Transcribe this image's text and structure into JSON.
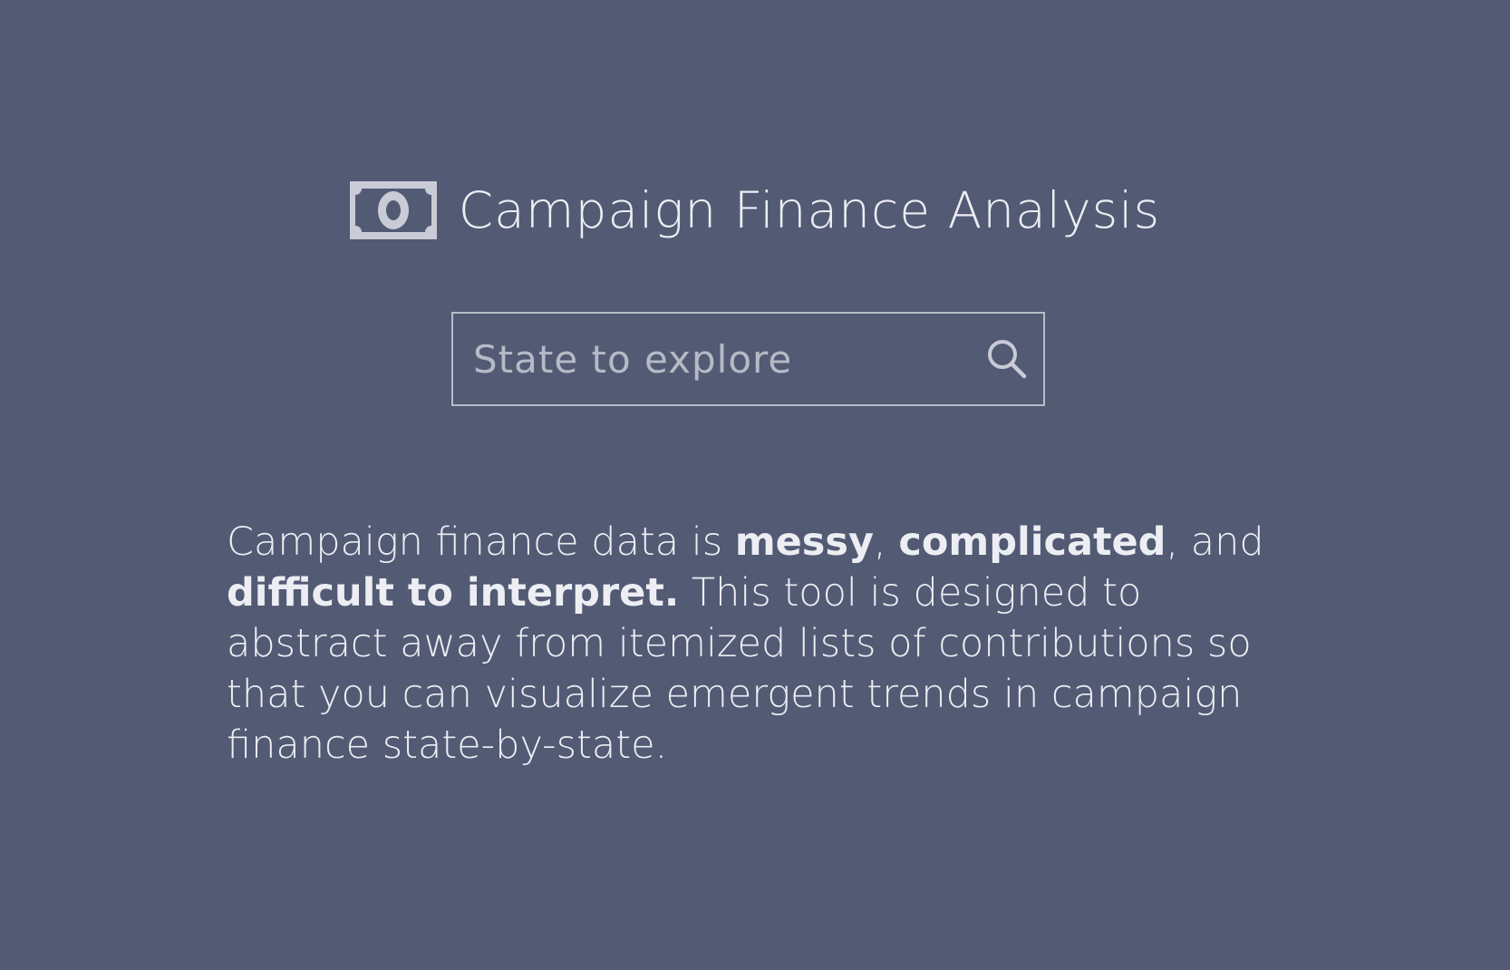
{
  "header": {
    "icon": "money-bill-icon",
    "title": "Campaign Finance Analysis"
  },
  "search": {
    "placeholder": "State to explore",
    "value": "",
    "icon": "search-icon"
  },
  "description": {
    "t1": "Campaign finance data is ",
    "b1": "messy",
    "t2": ", ",
    "b2": "complicated",
    "t3": ", and ",
    "b3": "difficult to interpret.",
    "t4": " This tool is designed to abstract away from itemized lists of contributions so that you can visualize emergent trends in campaign finance state-by-state."
  },
  "colors": {
    "background": "#535a74",
    "text": "#eceef3",
    "border": "#b9bdc9"
  }
}
